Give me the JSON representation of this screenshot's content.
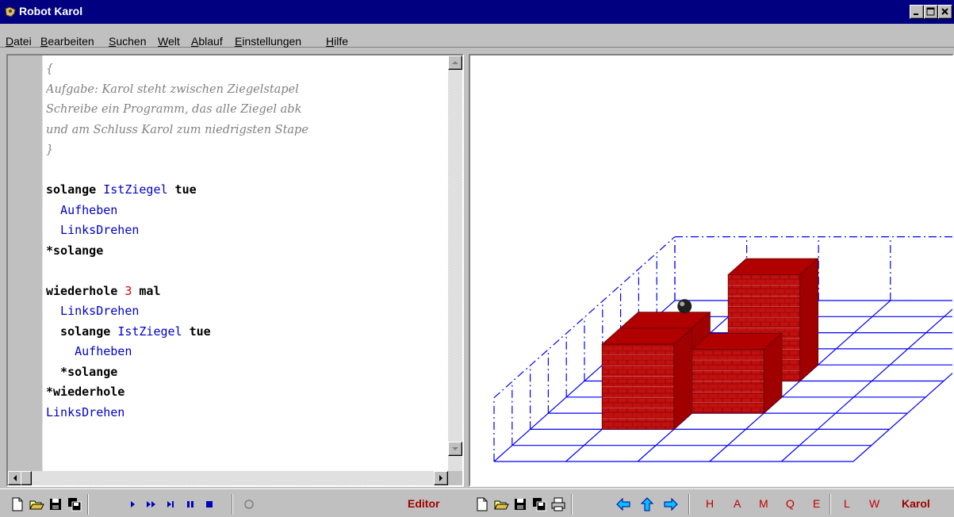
{
  "window": {
    "title": "Robot Karol"
  },
  "menu": [
    "Datei",
    "Bearbeiten",
    "Suchen",
    "Welt",
    "Ablauf",
    "Einstellungen",
    "Hilfe"
  ],
  "editor": {
    "lines": [
      [
        {
          "t": "{",
          "c": "cm"
        }
      ],
      [
        {
          "t": "Aufgabe: Karol steht zwischen Ziegelstapel",
          "c": "cm"
        }
      ],
      [
        {
          "t": "Schreibe ein Programm, das alle Ziegel abk",
          "c": "cm"
        }
      ],
      [
        {
          "t": "und am Schluss Karol zum niedrigsten Stape",
          "c": "cm"
        }
      ],
      [
        {
          "t": "}",
          "c": "cm"
        }
      ],
      [],
      [
        {
          "t": "solange ",
          "c": "kw"
        },
        {
          "t": "IstZiegel",
          "c": "cmd"
        },
        {
          "t": " tue",
          "c": "kw"
        }
      ],
      [
        {
          "t": "  Aufheben",
          "c": "cmd"
        }
      ],
      [
        {
          "t": "  LinksDrehen",
          "c": "cmd"
        }
      ],
      [
        {
          "t": "*solange",
          "c": "kw"
        }
      ],
      [],
      [
        {
          "t": "wiederhole ",
          "c": "kw"
        },
        {
          "t": "3",
          "c": "num"
        },
        {
          "t": " mal",
          "c": "kw"
        }
      ],
      [
        {
          "t": "  LinksDrehen",
          "c": "cmd"
        }
      ],
      [
        {
          "t": "  solange ",
          "c": "kw"
        },
        {
          "t": "IstZiegel",
          "c": "cmd"
        },
        {
          "t": " tue",
          "c": "kw"
        }
      ],
      [
        {
          "t": "    Aufheben",
          "c": "cmd"
        }
      ],
      [
        {
          "t": "  *solange",
          "c": "kw"
        }
      ],
      [
        {
          "t": "*wiederhole",
          "c": "kw"
        }
      ],
      [
        {
          "t": "LinksDrehen",
          "c": "cmd"
        }
      ]
    ]
  },
  "toolbar": {
    "editor_label": "Editor",
    "world_commands": [
      "H",
      "A",
      "M",
      "Q",
      "E"
    ],
    "view_commands": [
      "L",
      "W"
    ],
    "world_label": "Karol",
    "editor_icons": [
      "new-file-icon",
      "open-folder-icon",
      "save-disk-icon",
      "save-all-icon",
      "run-icon",
      "fast-run-icon",
      "step-icon",
      "pause-icon",
      "stop-icon",
      "status-indicator-icon"
    ],
    "world_icons": [
      "new-world-icon",
      "open-world-icon",
      "save-world-icon",
      "save-world-all-icon",
      "print-icon",
      "arrow-left-icon",
      "arrow-up-icon",
      "arrow-right-icon"
    ]
  },
  "world": {
    "columns": 5,
    "rows": 10,
    "height": 6,
    "colors": {
      "grid": "#0000ff",
      "brick": "#c01010",
      "mortar": "#e8e8e8"
    }
  },
  "colors": {
    "titlebar": "#000080",
    "command": "#0000cc",
    "keyword": "#000000",
    "comment": "#808080",
    "number": "#e00000",
    "toolbar_text": "#c00000"
  }
}
